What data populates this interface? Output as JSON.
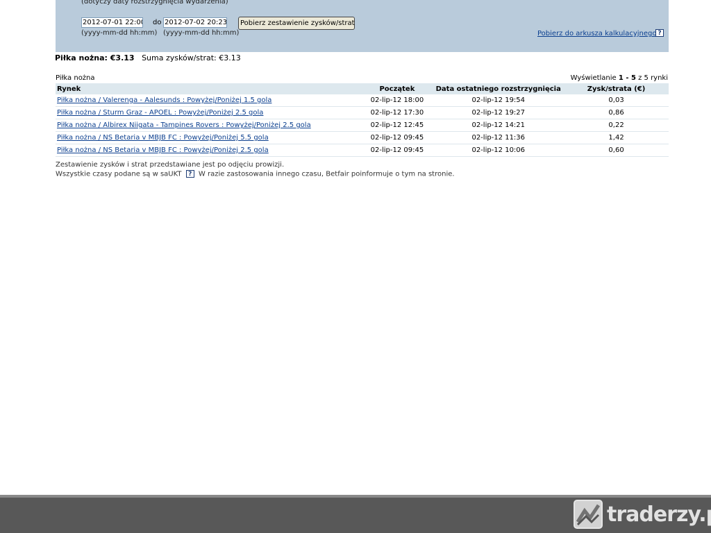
{
  "filter": {
    "note": "(dotyczy daty rozstrzygnięcia wydarzenia)",
    "from_value": "2012-07-01 22:00",
    "to_label": "do",
    "to_value": "2012-07-02 20:23",
    "format_hint_from": "(yyyy-mm-dd hh:mm)",
    "format_hint_to": "(yyyy-mm-dd hh:mm)",
    "fetch_button": "Pobierz zestawienie zysków/strat",
    "export_link": "Pobierz do arkusza kalkulacyjnego",
    "help_glyph": "?"
  },
  "summary": {
    "sport_total_label": "Piłka nożna: €3.13",
    "sum_label": "Suma zysków/strat:",
    "sum_value": "€3.13"
  },
  "table": {
    "section_label": "Piłka nożna",
    "pager_prefix": "Wyświetlanie",
    "pager_range": "1 - 5",
    "pager_suffix": "z 5 rynki",
    "headers": {
      "market": "Rynek",
      "start": "Początek",
      "settled": "Data ostatniego rozstrzygnięcia",
      "pl": "Zysk/strata (€)"
    },
    "rows": [
      {
        "market": "Piłka nożna / Valerenga - Aalesunds : Powyżej/Poniżej 1.5 gola",
        "start": "02-lip-12 18:00",
        "settled": "02-lip-12 19:54",
        "pl": "0,03"
      },
      {
        "market": "Piłka nożna / Sturm Graz - APOEL : Powyżej/Poniżej 2.5 gola",
        "start": "02-lip-12 17:30",
        "settled": "02-lip-12 19:27",
        "pl": "0,86"
      },
      {
        "market": "Piłka nożna / Albirex Niigata - Tampines Rovers : Powyżej/Poniżej 2.5 gola",
        "start": "02-lip-12 12:45",
        "settled": "02-lip-12 14:21",
        "pl": "0,22"
      },
      {
        "market": "Piłka nożna / NS Betaria v MBJB FC : Powyżej/Poniżej 5.5 gola",
        "start": "02-lip-12 09:45",
        "settled": "02-lip-12 11:36",
        "pl": "1,42"
      },
      {
        "market": "Piłka nożna / NS Betaria v MBJB FC : Powyżej/Poniżej 2.5 gola",
        "start": "02-lip-12 09:45",
        "settled": "02-lip-12 10:06",
        "pl": "0,60"
      }
    ]
  },
  "footnotes": {
    "commission": "Zestawienie zysków i strat przedstawiane jest po odjęciu prowizji.",
    "times_prefix": "Wszystkie czasy podane są w saUKT",
    "times_suffix": "W razie zastosowania innego czasu, Betfair poinformuje o tym na stronie."
  },
  "watermark": {
    "text": "traderzy.pl"
  }
}
